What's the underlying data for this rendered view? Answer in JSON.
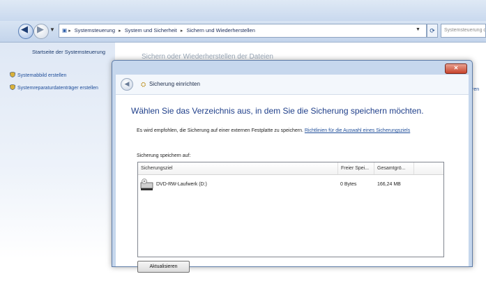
{
  "explorer": {
    "breadcrumb": [
      "Systemsteuerung",
      "System und Sicherheit",
      "Sichern und Wiederherstellen"
    ],
    "search_placeholder": "Systemsteuerung durchsuchen",
    "sidebar": {
      "home_link": "Startseite der Systemsteuerung",
      "links": [
        {
          "label": "Systemabbild erstellen",
          "icon": "shield-icon"
        },
        {
          "label": "Systemreparaturdatenträger erstellen",
          "icon": "shield-icon"
        }
      ]
    },
    "main_heading": "Sichern oder Wiederherstellen der Dateien",
    "main_right_fragment": "ren"
  },
  "dialog": {
    "title": "Sicherung einrichten",
    "instruction": "Wählen Sie das Verzeichnis aus, in dem Sie die Sicherung speichern möchten.",
    "recommendation_text": "Es wird empfohlen, die Sicherung auf einer externen Festplatte zu speichern.",
    "recommendation_link": "Richtlinien für die Auswahl eines Sicherungsziels",
    "save_label": "Sicherung speichern auf:",
    "columns": {
      "target": "Sicherungsziel",
      "free": "Freier Spei...",
      "total": "Gesamtgrö..."
    },
    "drives": [
      {
        "name": "DVD-RW-Laufwerk (D:)",
        "free": "0 Bytes",
        "total": "166,24 MB",
        "icon": "dvd-drive-icon"
      }
    ],
    "refresh_button": "Aktualisieren",
    "close_glyph": "✕"
  }
}
